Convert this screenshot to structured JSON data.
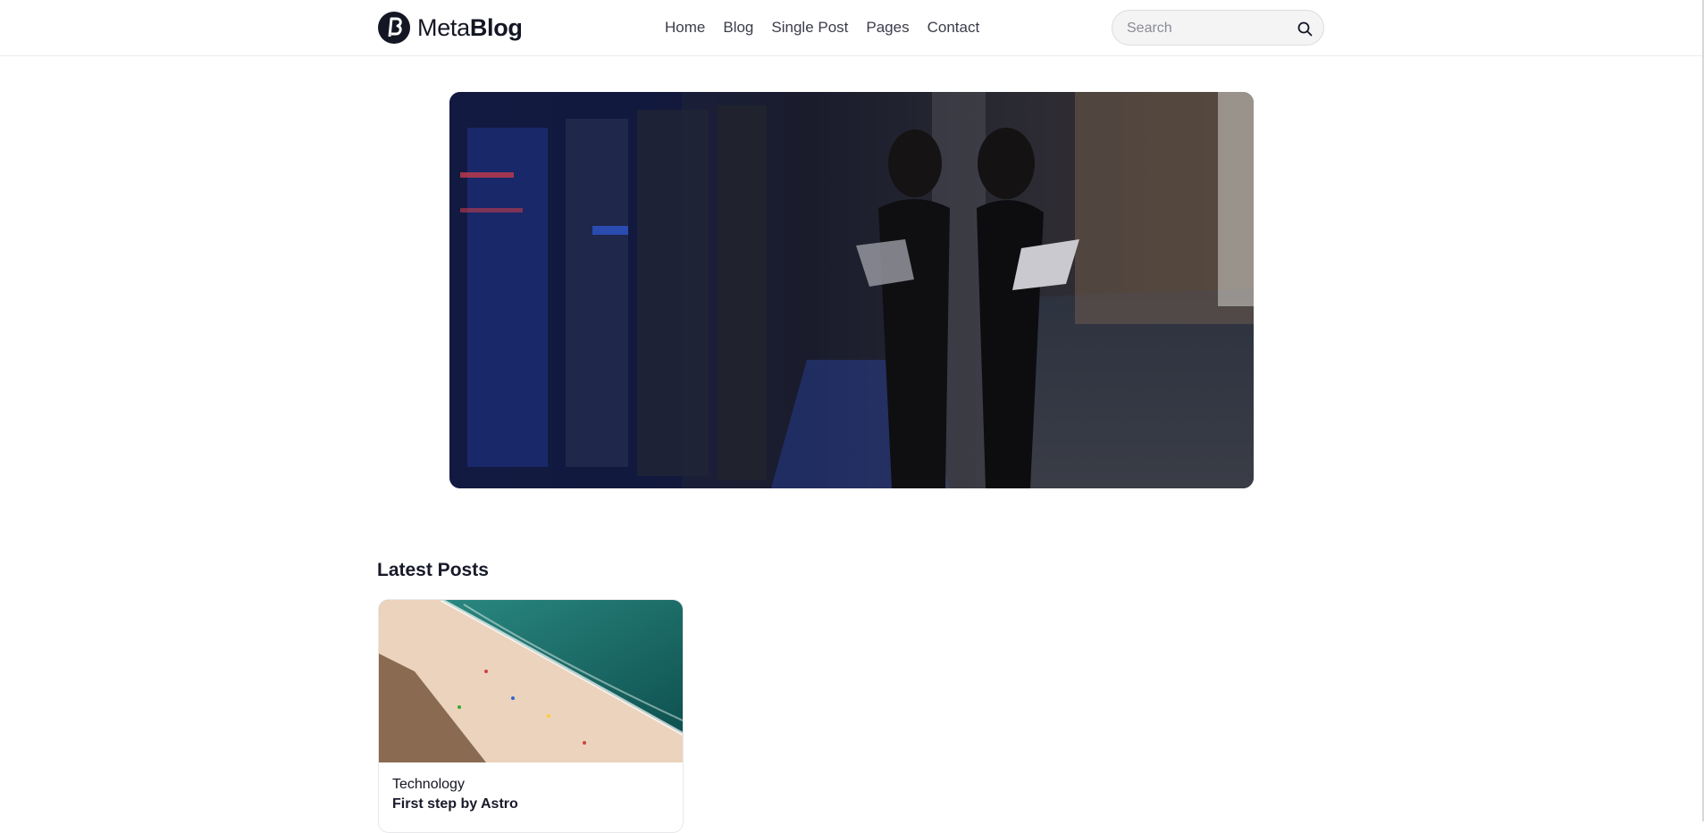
{
  "header": {
    "logo_light": "Meta",
    "logo_bold": "Blog",
    "nav": [
      "Home",
      "Blog",
      "Single Post",
      "Pages",
      "Contact"
    ],
    "search_placeholder": "Search"
  },
  "hero": {
    "image": "woman-with-laptop-in-server-room"
  },
  "latest_posts": {
    "title": "Latest Posts",
    "posts": [
      {
        "image": "aerial-beach-photo",
        "category": "Technology",
        "title": "First step by Astro"
      }
    ]
  },
  "icons": {
    "logo": "metablog-logo-icon",
    "search": "search-icon"
  },
  "colors": {
    "text": "#141624",
    "accent": "#4b6bfb"
  }
}
